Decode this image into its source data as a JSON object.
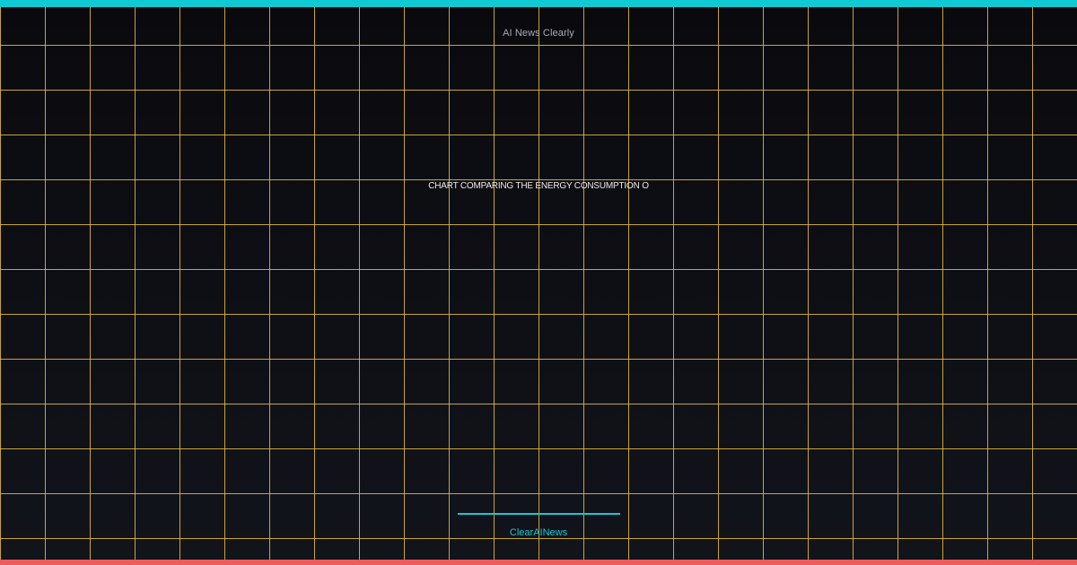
{
  "brand": {
    "name": "AI News Clearly"
  },
  "headline": {
    "text": "CHART COMPARING THE ENERGY CONSUMPTION O"
  },
  "footer": {
    "name": "ClearAINews"
  },
  "colors": {
    "top_bar": "#11c9d3",
    "bottom_bar": "#ef5b5b",
    "grid_line": "#e8be3c",
    "background": "#0a0a0e",
    "accent": "#19c7d2"
  }
}
